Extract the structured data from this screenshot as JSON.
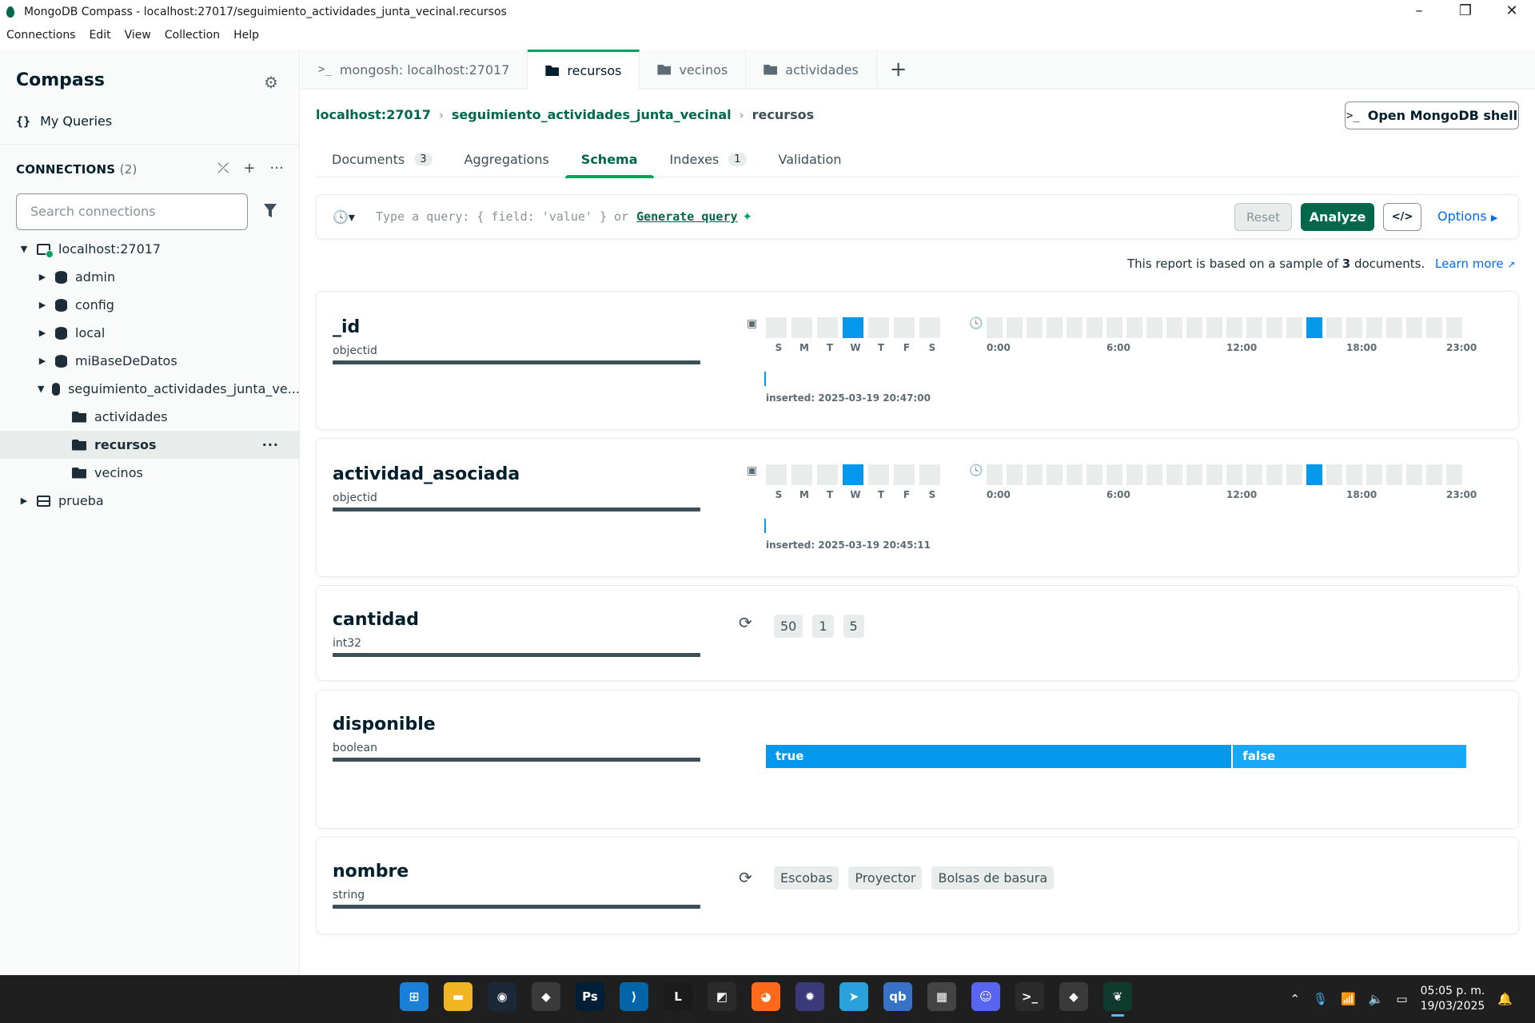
{
  "window": {
    "title": "MongoDB Compass - localhost:27017/seguimiento_actividades_junta_vecinal.recursos"
  },
  "menu": [
    "Connections",
    "Edit",
    "View",
    "Collection",
    "Help"
  ],
  "sidebar": {
    "brand": "Compass",
    "my_queries": "My Queries",
    "connections_label": "CONNECTIONS",
    "connections_count": "(2)",
    "search_placeholder": "Search connections",
    "tree": [
      {
        "label": "localhost:27017",
        "level": 0,
        "icon": "host-icon",
        "expanded": true
      },
      {
        "label": "admin",
        "level": 1,
        "icon": "database-icon",
        "expanded": false
      },
      {
        "label": "config",
        "level": 1,
        "icon": "database-icon",
        "expanded": false
      },
      {
        "label": "local",
        "level": 1,
        "icon": "database-icon",
        "expanded": false
      },
      {
        "label": "miBaseDeDatos",
        "level": 1,
        "icon": "database-icon",
        "expanded": false
      },
      {
        "label": "seguimiento_actividades_junta_ve...",
        "level": 1,
        "icon": "database-icon",
        "expanded": true
      },
      {
        "label": "actividades",
        "level": 2,
        "icon": "folder-icon"
      },
      {
        "label": "recursos",
        "level": 2,
        "icon": "folder-icon",
        "selected": true
      },
      {
        "label": "vecinos",
        "level": 2,
        "icon": "folder-icon"
      },
      {
        "label": "prueba",
        "level": 0,
        "icon": "server-icon",
        "expanded": false
      }
    ]
  },
  "workspace_tabs": [
    {
      "label": "mongosh: localhost:27017",
      "icon": "shell-icon"
    },
    {
      "label": "recursos",
      "icon": "folder-icon",
      "active": true
    },
    {
      "label": "vecinos",
      "icon": "folder-icon"
    },
    {
      "label": "actividades",
      "icon": "folder-icon"
    }
  ],
  "breadcrumb": {
    "host": "localhost:27017",
    "database": "seguimiento_actividades_junta_vecinal",
    "collection": "recursos"
  },
  "open_shell_label": "Open MongoDB shell",
  "sub_tabs": [
    {
      "label": "Documents",
      "badge": "3"
    },
    {
      "label": "Aggregations",
      "badge": ""
    },
    {
      "label": "Schema",
      "badge": "",
      "active": true
    },
    {
      "label": "Indexes",
      "badge": "1"
    },
    {
      "label": "Validation",
      "badge": ""
    }
  ],
  "query": {
    "placeholder": "Type a query: { field: 'value' } or",
    "generate_label": "Generate query",
    "reset_label": "Reset",
    "analyze_label": "Analyze",
    "options_label": "Options"
  },
  "report": {
    "prefix": "This report is based on a sample of",
    "count": "3",
    "suffix": "documents.",
    "learn_more": "Learn more"
  },
  "weekday_labels": [
    "S",
    "M",
    "T",
    "W",
    "T",
    "F",
    "S"
  ],
  "hour_labels": [
    "0:00",
    "6:00",
    "12:00",
    "18:00",
    "23:00"
  ],
  "fields": [
    {
      "name": "_id",
      "type": "objectid",
      "active_weekday": 3,
      "active_hour": 16,
      "inserted": "inserted: 2025-03-19 20:47:00"
    },
    {
      "name": "actividad_asociada",
      "type": "objectid",
      "active_weekday": 3,
      "active_hour": 16,
      "inserted": "inserted: 2025-03-19 20:45:11"
    },
    {
      "name": "cantidad",
      "type": "int32",
      "values": [
        "50",
        "1",
        "5"
      ]
    },
    {
      "name": "disponible",
      "type": "boolean",
      "bool": [
        {
          "label": "true",
          "fraction": 0.667,
          "color": "#0498ec"
        },
        {
          "label": "false",
          "fraction": 0.333,
          "color": "#19a7f7"
        }
      ]
    },
    {
      "name": "nombre",
      "type": "string",
      "values": [
        "Escobas",
        "Proyector",
        "Bolsas de basura"
      ]
    }
  ],
  "taskbar": {
    "apps": [
      "windows-start-icon",
      "file-explorer-icon",
      "steam-icon",
      "git-kraken-icon",
      "photoshop-icon",
      "vscode-icon",
      "league-icon",
      "app-icon",
      "firefox-icon",
      "app-icon-2",
      "telegram-icon",
      "qbittorrent-icon",
      "game-icon",
      "discord-icon",
      "terminal-icon",
      "git-icon",
      "mongodb-compass-icon"
    ],
    "time": "05:05 p. m.",
    "date": "19/03/2025"
  },
  "colors": {
    "accent": "#00684a",
    "accent_bright": "#00a35c",
    "histogram_on": "#0498ec",
    "link": "#016bf8"
  }
}
